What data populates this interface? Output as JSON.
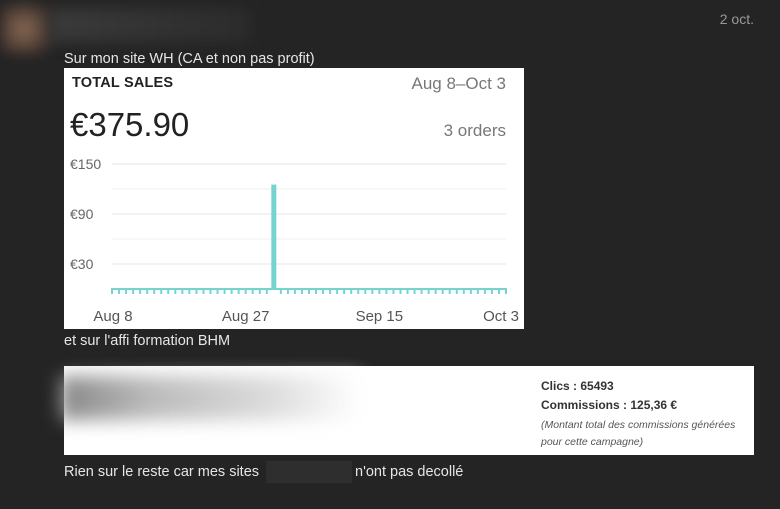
{
  "post": {
    "date": "2 oct.",
    "line1": "Sur mon site WH (CA et non pas profit)",
    "line2": "et sur l'affi formation BHM",
    "line3a": "Rien sur le reste car mes sites",
    "line3b": "n'ont pas decollé"
  },
  "sales_card": {
    "title": "TOTAL SALES",
    "range": "Aug 8–Oct 3",
    "amount": "€375.90",
    "orders": "3 orders"
  },
  "chart_data": {
    "type": "bar",
    "y_ticks": [
      "€150",
      "€90",
      "€30"
    ],
    "y_tick_values": [
      150,
      90,
      30
    ],
    "x_ticks": [
      "Aug 8",
      "Aug 27",
      "Sep 15",
      "Oct 3"
    ],
    "x_tick_days": [
      0,
      19,
      38,
      56
    ],
    "ylim": [
      0,
      150
    ],
    "grid": true,
    "days": 57,
    "values": [
      0,
      0,
      0,
      0,
      0,
      0,
      0,
      0,
      0,
      0,
      0,
      0,
      0,
      0,
      0,
      0,
      0,
      0,
      0,
      0,
      0,
      0,
      0,
      125.3,
      0,
      0,
      0,
      0,
      0,
      0,
      0,
      0,
      0,
      0,
      0,
      0,
      0,
      0,
      0,
      0,
      0,
      0,
      0,
      0,
      0,
      0,
      0,
      0,
      0,
      0,
      0,
      0,
      0,
      0,
      0,
      0,
      0
    ],
    "bar_color": "#77d3ce"
  },
  "affiliate": {
    "clics": "Clics : 65493",
    "commissions": "Commissions : 125,36 €",
    "note": "(Montant total des commissions générées pour cette campagne)"
  }
}
